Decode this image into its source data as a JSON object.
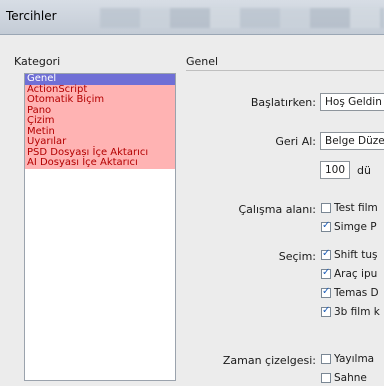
{
  "window": {
    "title": "Tercihler"
  },
  "sidebar": {
    "heading": "Kategori",
    "items": [
      {
        "label": "Genel",
        "selected": true
      },
      {
        "label": "ActionScript",
        "selected": false
      },
      {
        "label": "Otomatik Biçim",
        "selected": false
      },
      {
        "label": "Pano",
        "selected": false
      },
      {
        "label": "Çizim",
        "selected": false
      },
      {
        "label": "Metin",
        "selected": false
      },
      {
        "label": "Uyarılar",
        "selected": false
      },
      {
        "label": "PSD Dosyası İçe Aktarıcı",
        "selected": false
      },
      {
        "label": "AI Dosyası İçe Aktarıcı",
        "selected": false
      }
    ]
  },
  "main": {
    "heading": "Genel",
    "startup": {
      "label": "Başlatırken:",
      "value": "Hoş Geldin"
    },
    "undo": {
      "label": "Geri Al:",
      "value": "Belge Düze",
      "levels": "100",
      "levels_suffix": "dü"
    },
    "workspace": {
      "label": "Çalışma alanı:",
      "options": [
        {
          "text": "Test film",
          "checked": false
        },
        {
          "text": "Simge P",
          "checked": true
        }
      ]
    },
    "selection": {
      "label": "Seçim:",
      "options": [
        {
          "text": "Shift tuş",
          "checked": true
        },
        {
          "text": "Araç ipu",
          "checked": true
        },
        {
          "text": "Temas D",
          "checked": true
        },
        {
          "text": "3b film k",
          "checked": true
        }
      ]
    },
    "timeline": {
      "label": "Zaman çizelgesi:",
      "options": [
        {
          "text": "Yayılma",
          "checked": false
        },
        {
          "text": "Sahne",
          "checked": false
        }
      ]
    }
  }
}
